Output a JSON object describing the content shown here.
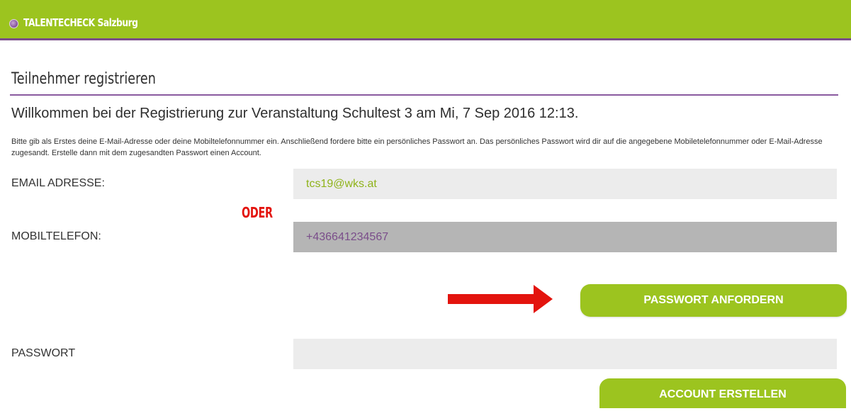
{
  "header": {
    "app_name": "TALENTECHECK Salzburg",
    "logo_icon": "globe-logo-icon",
    "bar_color": "#9cc41f",
    "accent_color": "#7a4d8a"
  },
  "page": {
    "title": "Teilnehmer registrieren",
    "welcome": "Willkommen bei der Registrierung zur Veranstaltung Schultest 3 am Mi, 7 Sep 2016 12:13.",
    "intro": "Bitte gib als Erstes deine E-Mail-Adresse oder deine Mobiltelefonnummer ein. Anschließend fordere bitte ein persönliches Passwort an. Das persönliches Passwort wird dir auf die angegebene Mobiletelefonnummer oder E-Mail-Adresse zugesandt. Erstelle dann mit dem zugesandten Passwort einen Account."
  },
  "form": {
    "email_label": "EMAIL ADRESSE:",
    "email_value": "tcs19@wks.at",
    "or_annotation": "ODER",
    "phone_label": "MOBILTELEFON:",
    "phone_value": "+436641234567",
    "request_button": "PASSWORT ANFORDERN",
    "password_label": "PASSWORT",
    "password_value": "",
    "create_button": "ACCOUNT ERSTELLEN"
  },
  "annotations": {
    "arrow_icon": "red-arrow-right-icon",
    "highlight_color": "#e3140e"
  }
}
